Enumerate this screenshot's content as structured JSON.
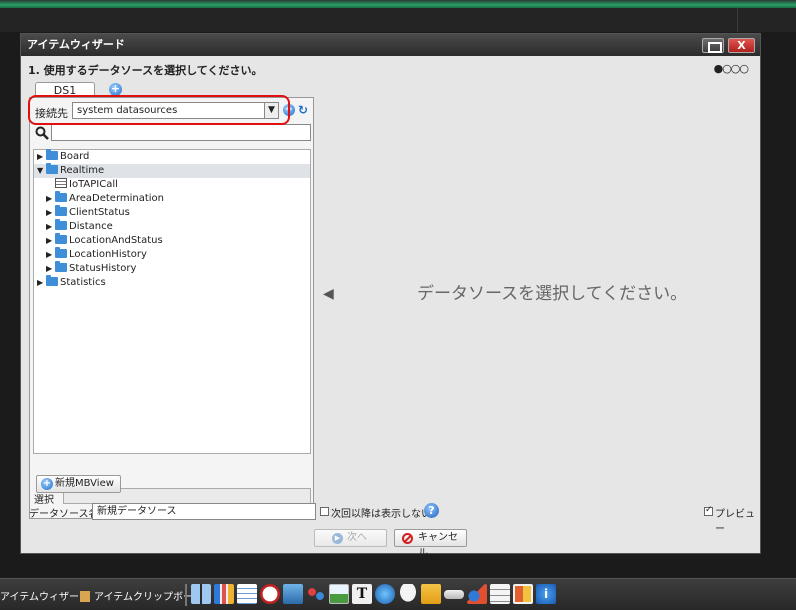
{
  "window": {
    "title": "アイテムウィザード",
    "close_label": "X"
  },
  "step": {
    "title": "1. 使用するデータソースを選択してください。",
    "dots": "●○○○"
  },
  "tabs": [
    {
      "label": "DS1"
    }
  ],
  "connection": {
    "label": "接続先",
    "selected": "system datasources"
  },
  "tree": [
    {
      "label": "Board",
      "level": 0,
      "expanded": false
    },
    {
      "label": "Realtime",
      "level": 0,
      "expanded": true
    },
    {
      "label": "IoTAPICall",
      "level": 1,
      "type": "table"
    },
    {
      "label": "AreaDetermination",
      "level": 1,
      "expanded": false
    },
    {
      "label": "ClientStatus",
      "level": 1,
      "expanded": false
    },
    {
      "label": "Distance",
      "level": 1,
      "expanded": false
    },
    {
      "label": "LocationAndStatus",
      "level": 1,
      "expanded": false
    },
    {
      "label": "LocationHistory",
      "level": 1,
      "expanded": false
    },
    {
      "label": "StatusHistory",
      "level": 1,
      "expanded": false
    },
    {
      "label": "Statistics",
      "level": 0,
      "expanded": false
    }
  ],
  "selection": {
    "label": "選択",
    "value": ""
  },
  "new_mbview_label": "新規MBView",
  "datasource": {
    "label": "データソース名",
    "value": "新規データソース"
  },
  "skip_checkbox": {
    "label": "次回以降は表示しない",
    "checked": false
  },
  "preview_checkbox": {
    "label": "プレビュー",
    "checked": true
  },
  "buttons": {
    "next": "次へ",
    "cancel": "キャンセル"
  },
  "placeholder_message": "データソースを選択してください。",
  "taskbar": {
    "item1": "アイテムウィザード",
    "item2": "アイテムクリップボード",
    "icons": [
      "layout-icon",
      "bar-chart-icon",
      "grid-icon",
      "clock-icon",
      "image-icon",
      "network-icon",
      "picture-icon",
      "text-icon",
      "globe-icon",
      "chat-icon",
      "folder-icon",
      "button-icon",
      "shapes-icon",
      "form-icon",
      "panel-icon",
      "info-icon"
    ]
  },
  "colors": {
    "accent": "#1e6fc8",
    "folder": "#3f8fd8",
    "highlight_box": "#e01010",
    "close_button": "#c4302b"
  }
}
